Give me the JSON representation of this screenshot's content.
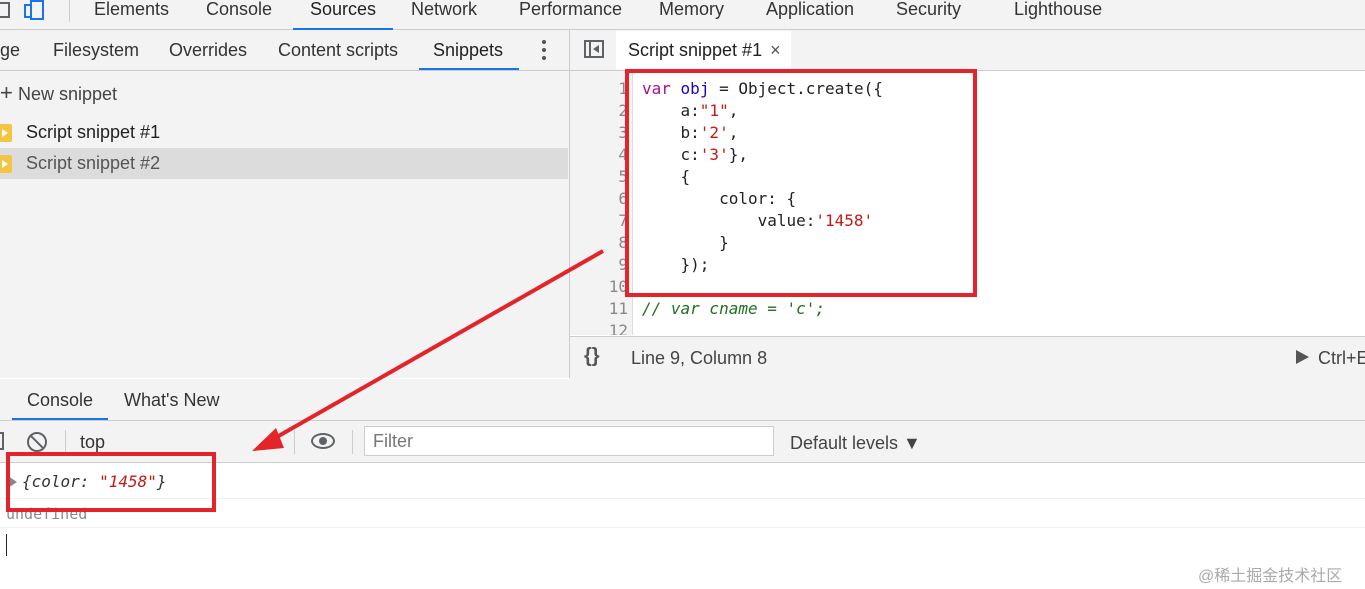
{
  "top_tabs": [
    "Elements",
    "Console",
    "Sources",
    "Network",
    "Performance",
    "Memory",
    "Application",
    "Security",
    "Lighthouse"
  ],
  "top_active_tab": "Sources",
  "navigator": {
    "tabs": [
      "ge",
      "Filesystem",
      "Overrides",
      "Content scripts",
      "Snippets"
    ],
    "active_tab": "Snippets",
    "new_snippet": "New snippet",
    "files": [
      {
        "name": "Script snippet #1",
        "selected": false
      },
      {
        "name": "Script snippet #2",
        "selected": true
      }
    ]
  },
  "editor": {
    "tab_label": "Script snippet #1",
    "close_glyph": "×",
    "line_numbers": [
      "1",
      "2",
      "3",
      "4",
      "5",
      "6",
      "7",
      "8",
      "9",
      "10",
      "11",
      "12"
    ],
    "cursor_position": "Line 9, Column 8",
    "format_glyph": "{}",
    "run_label": "Ctrl+E"
  },
  "drawer": {
    "tabs": [
      "Console",
      "What's New"
    ],
    "active_tab": "Console",
    "context": "top",
    "filter_placeholder": "Filter",
    "levels": "Default levels ▼",
    "output": {
      "object_preview": "{color: \"1458\"}",
      "undefined_text": "undefined"
    }
  },
  "watermark": "@稀土掘金技术社区",
  "colors": {
    "accent": "#1a73e8",
    "annotation_red": "#e3242b",
    "keyword": "#aa0d91",
    "string": "#c41a16",
    "comment": "#236e25"
  }
}
